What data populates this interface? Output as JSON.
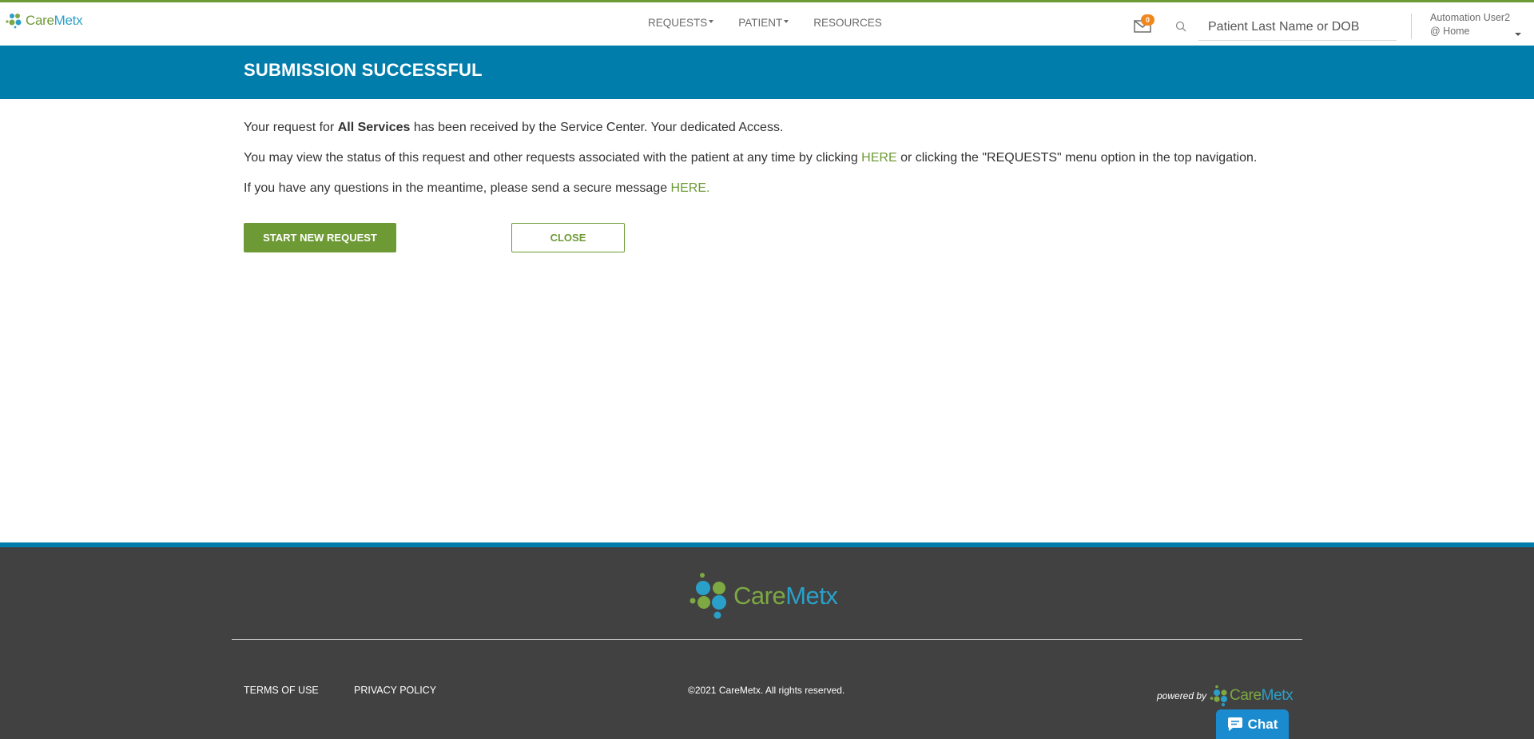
{
  "app": {
    "brand_part1": "Care",
    "brand_part2": "Metx",
    "accent_color": "#6e9a36",
    "primary_color": "#007dab"
  },
  "header": {
    "nav": [
      {
        "label": "REQUESTS",
        "has_dropdown": true
      },
      {
        "label": "PATIENT",
        "has_dropdown": true
      },
      {
        "label": "RESOURCES",
        "has_dropdown": false
      }
    ],
    "messages_icon": "envelope-icon",
    "messages_count": "0",
    "search_icon": "search-icon",
    "search_placeholder": "Patient Last Name or DOB",
    "user_name": "Automation User2",
    "user_location": "@ Home"
  },
  "banner": {
    "title": "SUBMISSION SUCCESSFUL"
  },
  "content": {
    "line1_pre": "Your request for ",
    "line1_bold": "All Services",
    "line1_post": " has been received by the Service Center. Your dedicated Access.",
    "line2_pre": "You may view the status of this request and other requests associated with the patient at any time by clicking ",
    "line2_link": "HERE",
    "line2_post": " or clicking the \"REQUESTS\" menu option in the top navigation.",
    "line3_pre": "If you have any questions in the meantime, please send a secure message ",
    "line3_link": "HERE."
  },
  "actions": {
    "primary_label": "START NEW REQUEST",
    "secondary_label": "CLOSE"
  },
  "footer": {
    "terms_label": "TERMS OF USE",
    "privacy_label": "PRIVACY POLICY",
    "copyright": "©2021 CareMetx. All rights reserved.",
    "powered_by": "powered by",
    "chat_label": "Chat"
  }
}
